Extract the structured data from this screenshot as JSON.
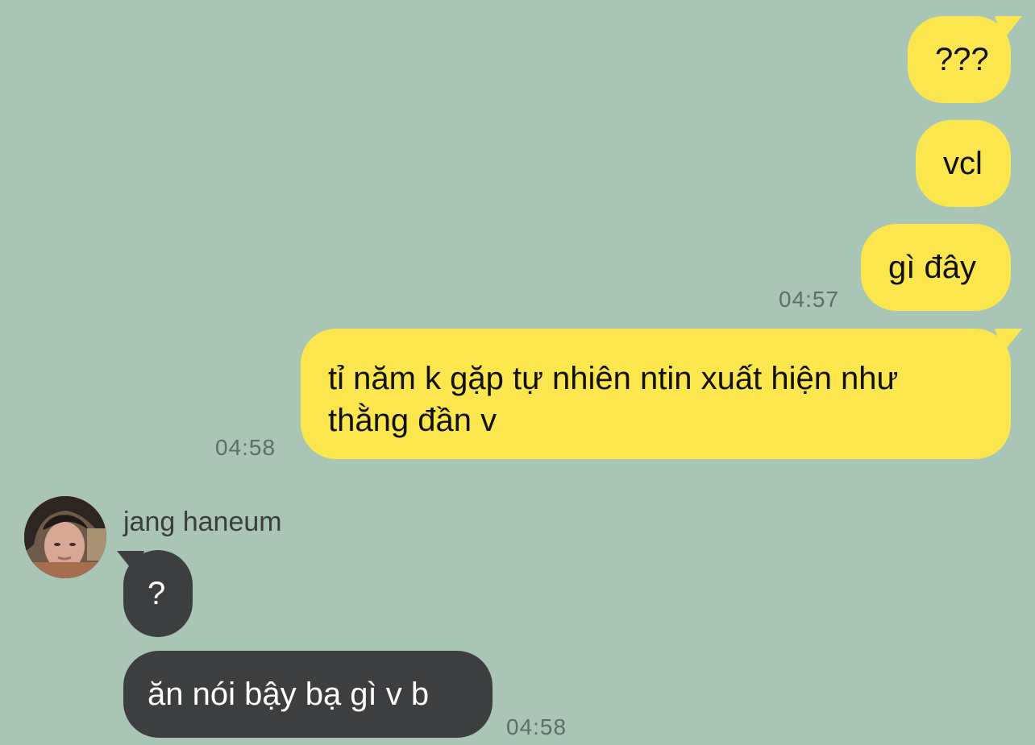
{
  "messages": {
    "m1": "???",
    "m2": "vcl",
    "m3": "gì đây",
    "m4_line1": "tỉ năm k gặp tự nhiên ntin xuất hiện như",
    "m4_line2": "thằng đần v",
    "m5": "?",
    "m6": "ăn nói bậy bạ gì v b"
  },
  "timestamps": {
    "t1": "04:57",
    "t2": "04:58",
    "t3": "04:58"
  },
  "contact": {
    "name": "jang haneum"
  },
  "colors": {
    "background": "#a8c5b6",
    "outgoing": "#fbe64e",
    "incoming": "#3d3e40"
  }
}
